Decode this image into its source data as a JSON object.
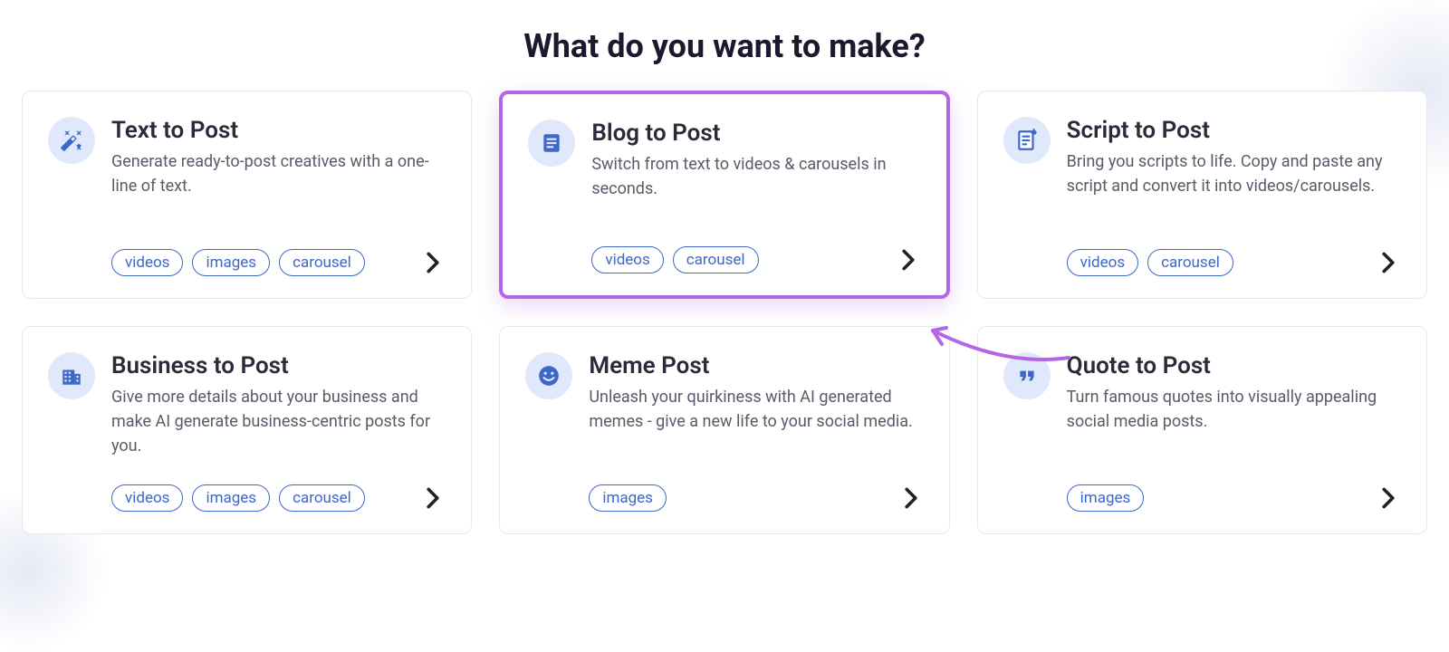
{
  "title": "What do you want to make?",
  "cards": [
    {
      "title": "Text to Post",
      "desc": "Generate ready-to-post creatives with a one-line of text.",
      "tags": [
        "videos",
        "images",
        "carousel"
      ],
      "icon": "wand",
      "highlighted": false
    },
    {
      "title": "Blog to Post",
      "desc": "Switch from text to videos & carousels in seconds.",
      "tags": [
        "videos",
        "carousel"
      ],
      "icon": "document",
      "highlighted": true
    },
    {
      "title": "Script to Post",
      "desc": "Bring you scripts to life. Copy and paste any script and convert it into videos/carousels.",
      "tags": [
        "videos",
        "carousel"
      ],
      "icon": "script",
      "highlighted": false
    },
    {
      "title": "Business to Post",
      "desc": "Give more details about your business and make AI generate business-centric posts for you.",
      "tags": [
        "videos",
        "images",
        "carousel"
      ],
      "icon": "building",
      "highlighted": false
    },
    {
      "title": "Meme Post",
      "desc": "Unleash your quirkiness with AI generated memes - give a new life to your social media.",
      "tags": [
        "images"
      ],
      "icon": "smile",
      "highlighted": false
    },
    {
      "title": "Quote to Post",
      "desc": "Turn famous quotes into visually appealing social media posts.",
      "tags": [
        "images"
      ],
      "icon": "quote",
      "highlighted": false
    }
  ],
  "colors": {
    "accent": "#3e67c7",
    "highlight": "#b366e6"
  }
}
